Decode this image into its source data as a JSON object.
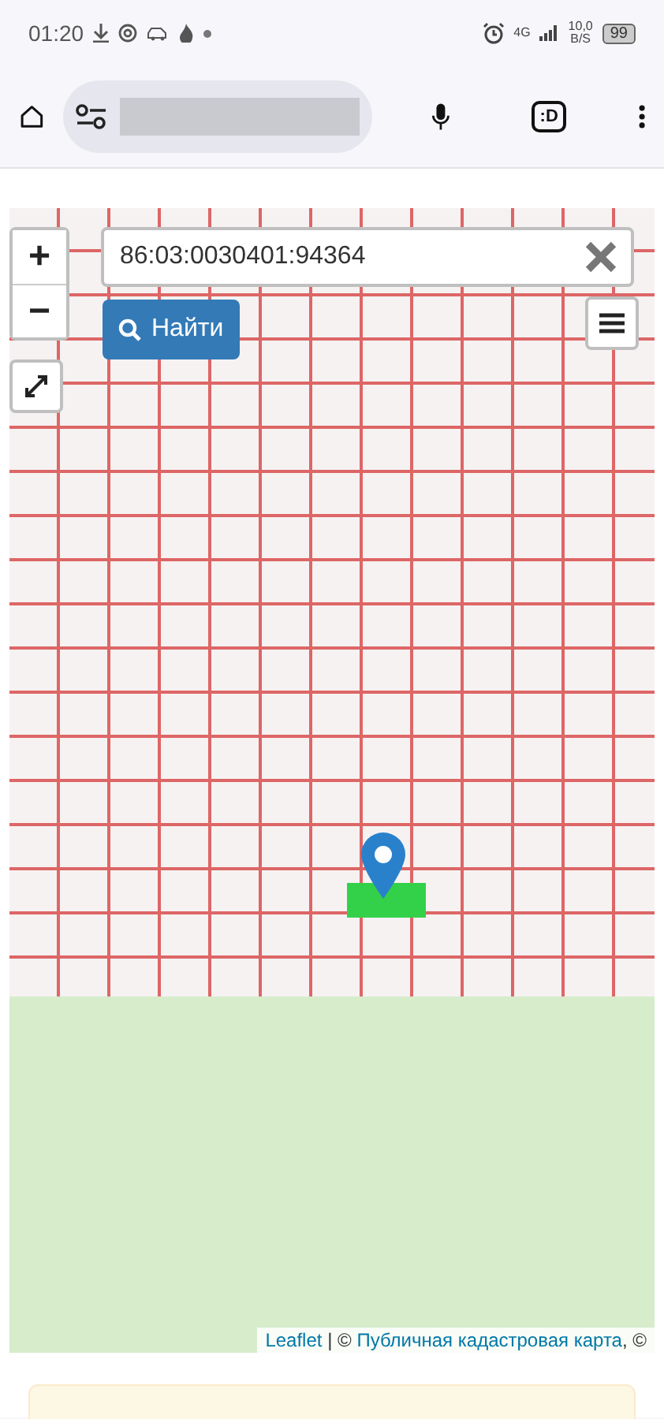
{
  "status_bar": {
    "time": "01:20",
    "network": "4G",
    "speed": "10,0",
    "speed_unit": "B/S",
    "battery": "99"
  },
  "browser_bar": {
    "tab_button": ":D"
  },
  "map": {
    "zoom_in": "+",
    "zoom_out": "−",
    "search": {
      "value": "86:03:0030401:94364"
    },
    "find_button": "Найти",
    "attribution": [
      {
        "text": "Leaflet",
        "kind": "link"
      },
      {
        "text": " | © ",
        "kind": "text"
      },
      {
        "text": "Публичная кадастровая карта",
        "kind": "link"
      },
      {
        "text": ", ©",
        "kind": "text"
      }
    ]
  }
}
